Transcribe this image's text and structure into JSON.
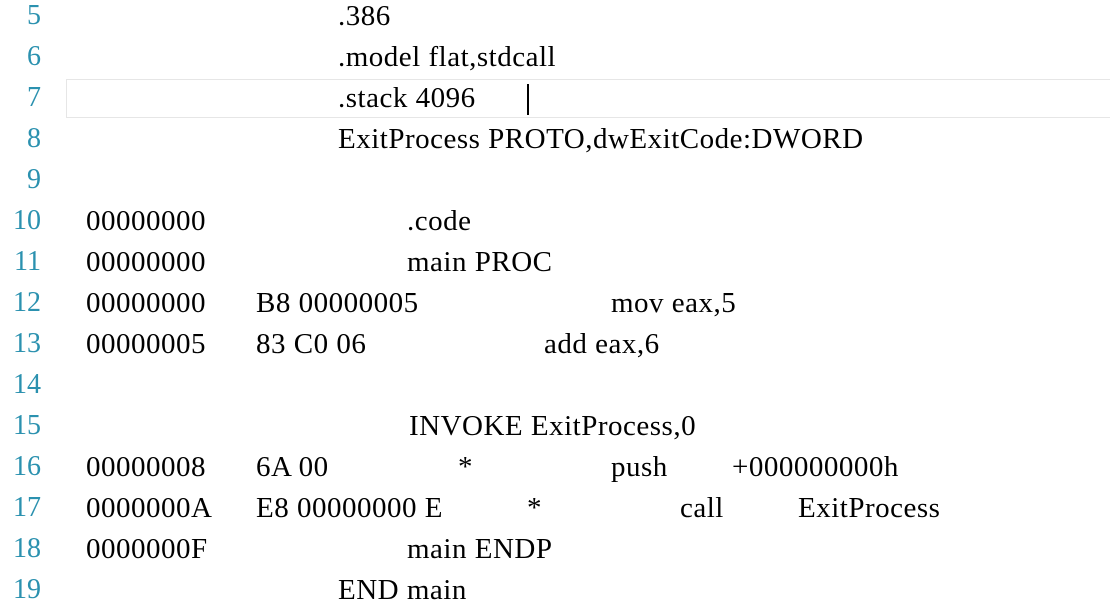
{
  "editor": {
    "lines": [
      {
        "number": "5",
        "address": "",
        "bytes": "",
        "marker": "",
        "source": ".386"
      },
      {
        "number": "6",
        "address": "",
        "bytes": "",
        "marker": "",
        "source": ".model flat,stdcall"
      },
      {
        "number": "7",
        "address": "",
        "bytes": "",
        "marker": "",
        "source": ".stack 4096"
      },
      {
        "number": "8",
        "address": "",
        "bytes": "",
        "marker": "",
        "source": "ExitProcess PROTO,dwExitCode:DWORD"
      },
      {
        "number": "9",
        "address": "",
        "bytes": "",
        "marker": "",
        "source": ""
      },
      {
        "number": "10",
        "address": "00000000",
        "bytes": "",
        "marker": "",
        "source": ".code"
      },
      {
        "number": "11",
        "address": "00000000",
        "bytes": "",
        "marker": "",
        "source": "main PROC"
      },
      {
        "number": "12",
        "address": "00000000",
        "bytes": "B8 00000005",
        "marker": "",
        "source": "mov eax,5"
      },
      {
        "number": "13",
        "address": "00000005",
        "bytes": "83 C0 06",
        "marker": "",
        "source": "add eax,6"
      },
      {
        "number": "14",
        "address": "",
        "bytes": "",
        "marker": "",
        "source": ""
      },
      {
        "number": "15",
        "address": "",
        "bytes": "",
        "marker": "",
        "source": "INVOKE ExitProcess,0"
      },
      {
        "number": "16",
        "address": "00000008",
        "bytes": "6A 00",
        "marker": "*",
        "source": "push",
        "operand": "+000000000h"
      },
      {
        "number": "17",
        "address": "0000000A",
        "bytes": "E8 00000000 E",
        "marker": "*",
        "source": "call",
        "operand": "ExitProcess"
      },
      {
        "number": "18",
        "address": "0000000F",
        "bytes": "",
        "marker": "",
        "source": "main ENDP"
      },
      {
        "number": "19",
        "address": "",
        "bytes": "",
        "marker": "",
        "source": "END main"
      }
    ],
    "current_line_index": 2,
    "colors": {
      "line_number": "#2b91af",
      "text": "#000000",
      "current_line_border": "#e6e6e6",
      "background": "#ffffff"
    }
  }
}
